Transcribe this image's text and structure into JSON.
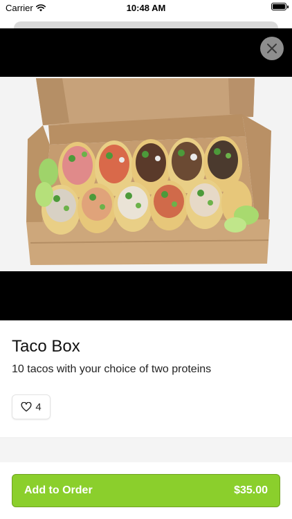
{
  "status_bar": {
    "carrier": "Carrier",
    "time": "10:48 AM"
  },
  "item": {
    "title": "Taco Box",
    "description": "10 tacos with your choice of two proteins",
    "likes": "4"
  },
  "order_button": {
    "label": "Add to Order",
    "price": "$35.00"
  },
  "colors": {
    "accent": "#8bcf2c",
    "media_bg": "#000000"
  },
  "icons": {
    "close": "close-icon",
    "heart": "heart-icon",
    "wifi": "wifi-icon",
    "battery": "battery-icon"
  }
}
